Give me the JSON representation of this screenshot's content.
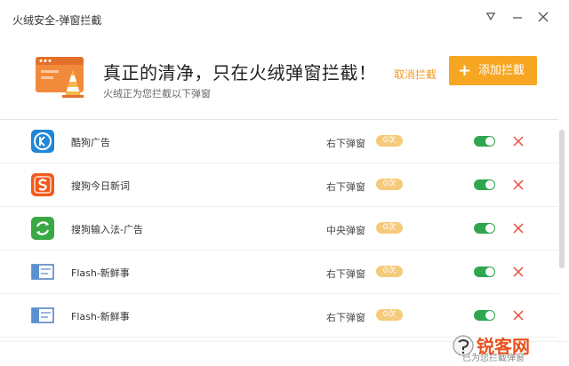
{
  "window": {
    "title": "火绒安全-弹窗拦截",
    "menu_icon": "filter-menu-icon",
    "minimize_icon": "minimize-icon",
    "close_icon": "close-icon"
  },
  "hero": {
    "headline": "真正的清净，只在火绒弹窗拦截！",
    "subline": "火绒正为您拦截以下弹窗",
    "cancel_label": "取消拦截",
    "add_label": "添加拦截",
    "logo_icon": "popup-block-logo-icon"
  },
  "rows": [
    {
      "name": "酷狗广告",
      "type": "右下弹窗",
      "count": "0次",
      "icon": "kugou-icon",
      "enabled": true
    },
    {
      "name": "搜狗今日新词",
      "type": "右下弹窗",
      "count": "0次",
      "icon": "sogou-icon",
      "enabled": true
    },
    {
      "name": "搜狗输入法-广告",
      "type": "中央弹窗",
      "count": "0次",
      "icon": "sogou-input-icon",
      "enabled": true
    },
    {
      "name": "Flash-新鲜事",
      "type": "右下弹窗",
      "count": "0次",
      "icon": "flash-window-icon",
      "enabled": true
    },
    {
      "name": "Flash-新鲜事",
      "type": "右下弹窗",
      "count": "0次",
      "icon": "flash-window-icon",
      "enabled": true
    }
  ],
  "footer": {
    "text": "已为您拦截弹窗"
  },
  "watermark": {
    "text": "锐客网"
  },
  "colors": {
    "accent": "#f6a623",
    "link": "#f39a1e",
    "toggle_on": "#2fa64f",
    "delete": "#e84c3d",
    "badge": "#f5ca7a"
  }
}
